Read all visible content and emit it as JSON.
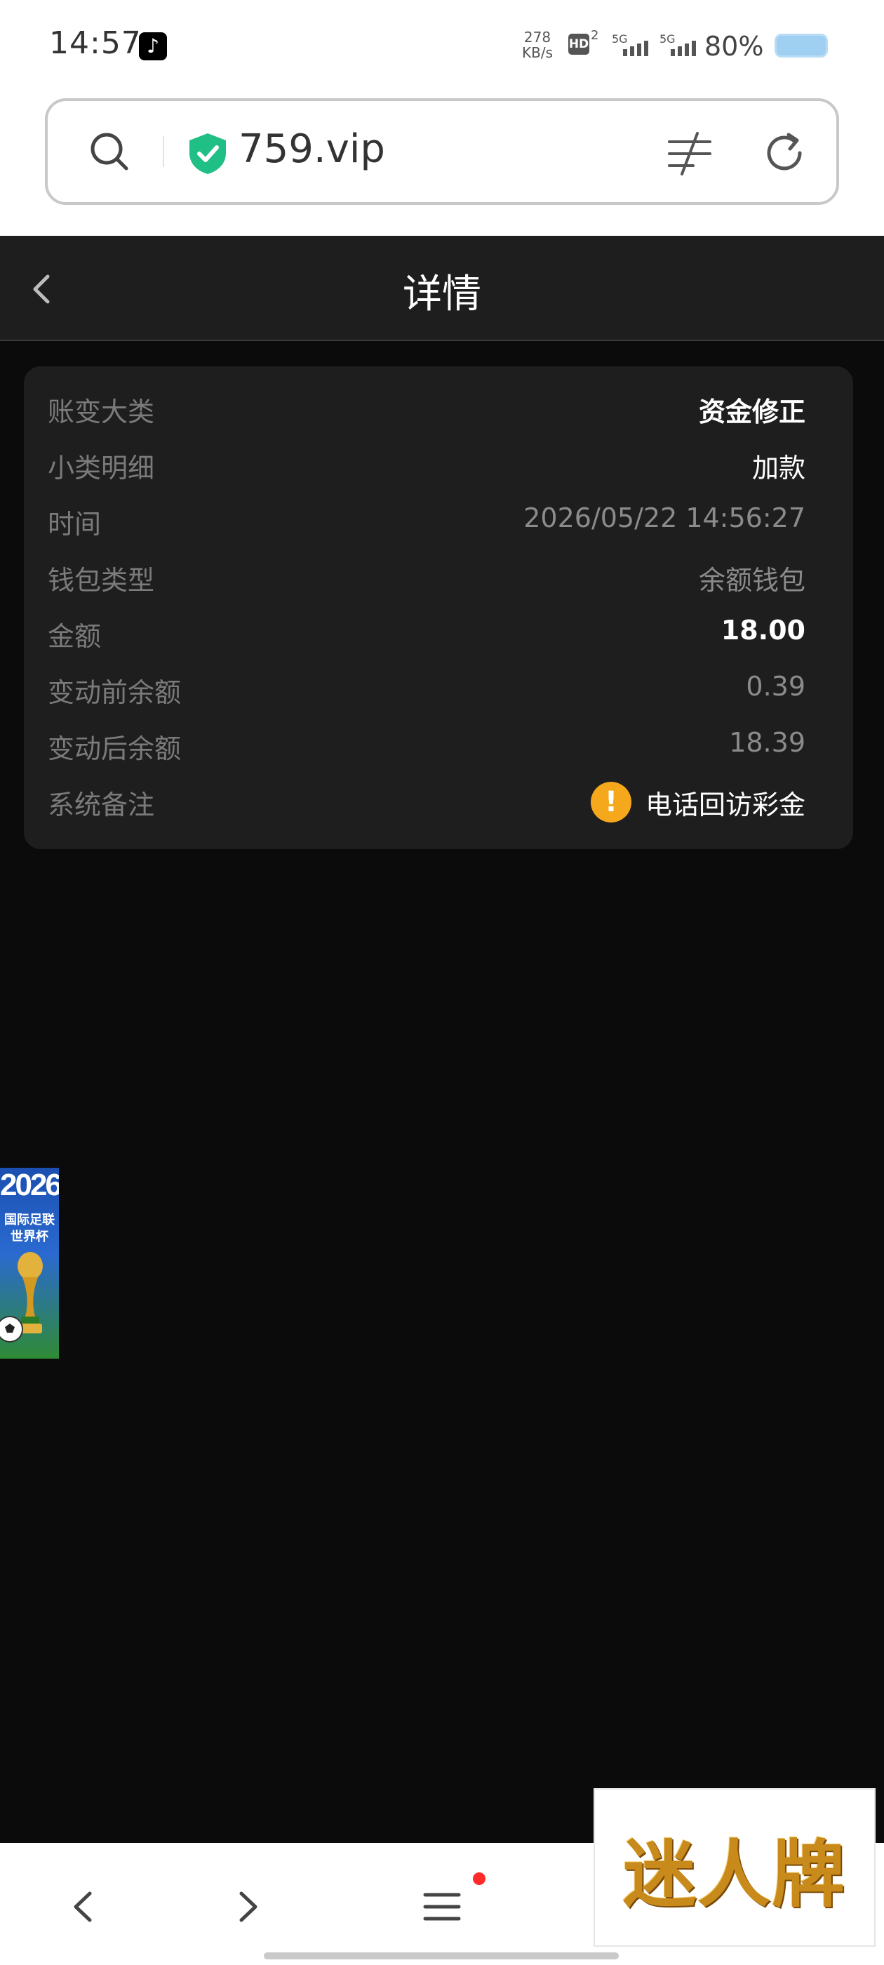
{
  "status_bar": {
    "time": "14:57",
    "net_speed_value": "278",
    "net_speed_unit": "KB/s",
    "hd_label": "HD",
    "hd_sub": "2",
    "sim1": "5G",
    "sim2": "5G",
    "battery": "80%"
  },
  "browser": {
    "domain": "759.vip"
  },
  "header": {
    "title": "详情"
  },
  "details": {
    "rows": [
      {
        "label": "账变大类",
        "value": "资金修正"
      },
      {
        "label": "小类明细",
        "value": "加款"
      },
      {
        "label": "时间",
        "value": "2026/05/22 14:56:27"
      },
      {
        "label": "钱包类型",
        "value": "余额钱包"
      },
      {
        "label": "金额",
        "value": "18.00"
      },
      {
        "label": "变动前余额",
        "value": "0.39"
      },
      {
        "label": "变动后余额",
        "value": "18.39"
      },
      {
        "label": "系统备注",
        "value": "电话回访彩金"
      }
    ]
  },
  "float_ad": {
    "year": "2026",
    "line1": "国际足联",
    "line2": "世界杯"
  },
  "logo_ad": {
    "text": "迷人牌"
  },
  "colors": {
    "page_bg": "#0b0b0b",
    "card_bg": "#1e1e1e",
    "warning": "#f5a81c",
    "secure": "#1fbf86"
  }
}
